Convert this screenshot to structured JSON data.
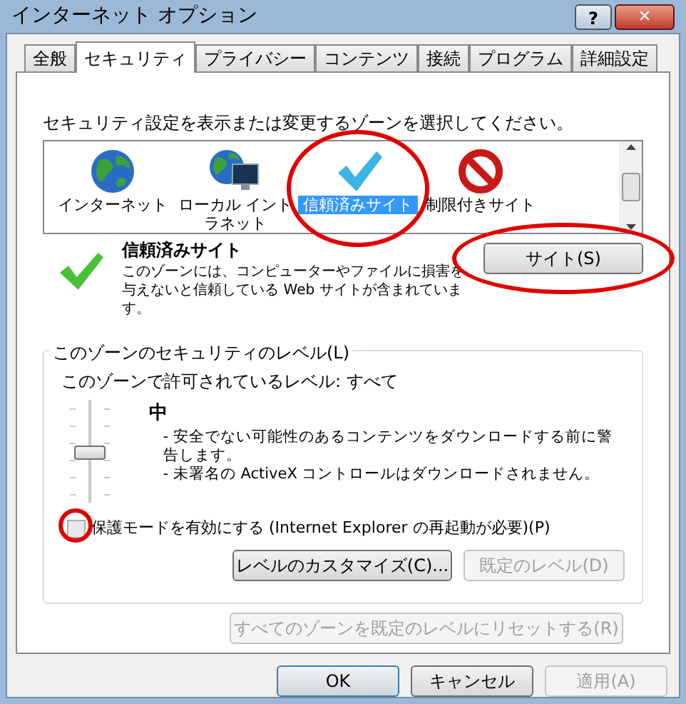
{
  "window": {
    "title": "インターネット オプション",
    "help": "?",
    "close": "✕"
  },
  "tabs": [
    {
      "label": "全般",
      "selected": false
    },
    {
      "label": "セキュリティ",
      "selected": true
    },
    {
      "label": "プライバシー",
      "selected": false
    },
    {
      "label": "コンテンツ",
      "selected": false
    },
    {
      "label": "接続",
      "selected": false
    },
    {
      "label": "プログラム",
      "selected": false
    },
    {
      "label": "詳細設定",
      "selected": false
    }
  ],
  "zone_prompt": "セキュリティ設定を表示または変更するゾーンを選択してください。",
  "zones": [
    {
      "label": "インターネット",
      "kind": "globe",
      "selected": false,
      "highlighted": false
    },
    {
      "label": "ローカル イントラネット",
      "kind": "intranet",
      "selected": false,
      "highlighted": false
    },
    {
      "label": "信頼済みサイト",
      "kind": "check",
      "selected": true,
      "highlighted": true
    },
    {
      "label": "制限付きサイト",
      "kind": "forbidden",
      "selected": false,
      "highlighted": false
    }
  ],
  "zone_info": {
    "name": "信頼済みサイト",
    "description": "このゾーンには、コンピューターやファイルに損害を与えないと信頼している Web サイトが含まれています。"
  },
  "sites_button": {
    "label": "サイト(S)",
    "highlighted": true
  },
  "level_group": {
    "title": "このゾーンのセキュリティのレベル(L)",
    "allowed": "このゾーンで許可されているレベル: すべて",
    "level_name": "中",
    "level": 0.5,
    "bullets": [
      "- 安全でない可能性のあるコンテンツをダウンロードする前に警告します。",
      "- 未署名の ActiveX コントロールはダウンロードされません。"
    ]
  },
  "protected_mode": {
    "label": "保護モードを有効にする (Internet Explorer の再起動が必要)(P)",
    "checked": false,
    "disabled": true,
    "highlighted": true
  },
  "level_buttons": [
    {
      "label": "レベルのカスタマイズ(C)...",
      "disabled": false
    },
    {
      "label": "既定のレベル(D)",
      "disabled": true
    }
  ],
  "reset_button": {
    "label": "すべてのゾーンを既定のレベルにリセットする(R)",
    "disabled": true
  },
  "footer_buttons": [
    {
      "label": "OK",
      "disabled": false,
      "default": true
    },
    {
      "label": "キャンセル",
      "disabled": false,
      "default": false
    },
    {
      "label": "適用(A)",
      "disabled": true,
      "default": false
    }
  ]
}
